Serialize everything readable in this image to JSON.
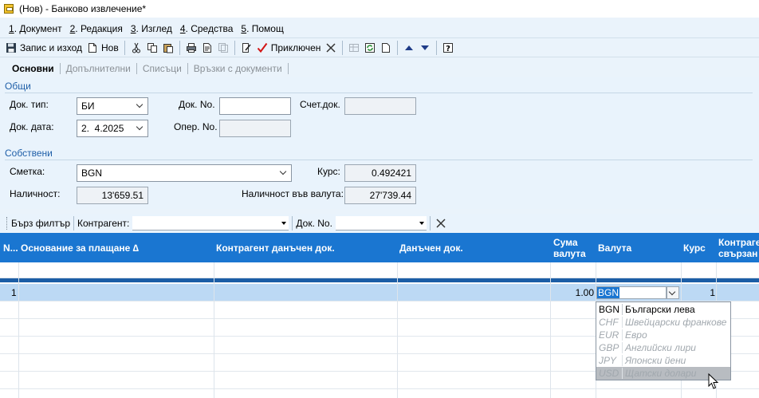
{
  "window": {
    "title": "(Нов) - Банково извлечение*"
  },
  "menu": [
    {
      "num": "1",
      "label": ". Документ"
    },
    {
      "num": "2",
      "label": ". Редакция"
    },
    {
      "num": "3",
      "label": ". Изглед"
    },
    {
      "num": "4",
      "label": ". Средства"
    },
    {
      "num": "5",
      "label": ". Помощ"
    }
  ],
  "toolbar": {
    "save_exit_label": "Запис и изход",
    "new_label": "Нов",
    "finished_label": "Приключен"
  },
  "tabs": [
    {
      "label": "Основни",
      "active": true
    },
    {
      "label": "Допълнителни",
      "active": false
    },
    {
      "label": "Списъци",
      "active": false
    },
    {
      "label": "Връзки с документи",
      "active": false
    }
  ],
  "general": {
    "section_title": "Общи",
    "doc_type_label": "Док. тип:",
    "doc_type_value": "БИ",
    "doc_date_label": "Док. дата:",
    "doc_date_value": "2.  4.2025",
    "doc_no_label": "Док. No.",
    "doc_no_value": "",
    "oper_no_label": "Опер. No.",
    "oper_no_value": "",
    "acc_doc_label": "Счет.док.",
    "acc_doc_value": ""
  },
  "own": {
    "section_title": "Собствени",
    "account_label": "Сметка:",
    "account_value": "BGN",
    "rate_label": "Курс:",
    "rate_value": "0.492421",
    "availability_label": "Наличност:",
    "availability_value": "13'659.51",
    "availability_currency_label": "Наличност във валута:",
    "availability_currency_value": "27'739.44"
  },
  "filter": {
    "quick_filter_label": "Бърз филтър",
    "counterparty_label": "Контрагент:",
    "counterparty_value": "",
    "doc_no_label": "Док. No.",
    "doc_no_value": ""
  },
  "grid": {
    "columns": {
      "no": "N...",
      "payment_basis": "Основание за плащане ∆",
      "counterparty_tax_doc": "Контрагент данъчен док.",
      "tax_doc": "Данъчен док.",
      "amount_currency_1": "Сума",
      "amount_currency_2": "валута",
      "currency": "Валута",
      "rate": "Курс",
      "counterparty_linked_1": "Контраге",
      "counterparty_linked_2": "свързан"
    },
    "rows": [
      {
        "no": "1",
        "amount": "1.00",
        "currency": "BGN",
        "rate": "1"
      }
    ]
  },
  "currency_dropdown": {
    "options": [
      {
        "code": "BGN",
        "name": "Български лева",
        "state": "normal"
      },
      {
        "code": "CHF",
        "name": "Швейцарски франкове",
        "state": "muted"
      },
      {
        "code": "EUR",
        "name": "Евро",
        "state": "muted"
      },
      {
        "code": "GBP",
        "name": "Английски лири",
        "state": "muted"
      },
      {
        "code": "JPY",
        "name": "Японски йени",
        "state": "muted"
      },
      {
        "code": "USD",
        "name": "Щатски долари",
        "state": "hover"
      }
    ]
  }
}
